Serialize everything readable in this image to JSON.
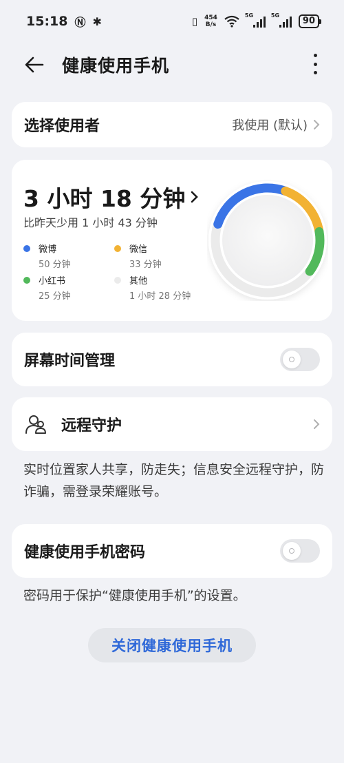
{
  "status_bar": {
    "time": "15:18",
    "net_speed_value": "454",
    "net_speed_unit": "B/s",
    "signal_1_label": "5G",
    "signal_2_label": "5G",
    "battery": "90"
  },
  "header": {
    "title": "健康使用手机"
  },
  "user_select": {
    "label": "选择使用者",
    "value": "我使用 (默认)"
  },
  "usage": {
    "total": "3 小时 18 分钟",
    "compare": "比昨天少用 1 小时 43 分钟",
    "apps": [
      {
        "name": "微博",
        "duration": "50 分钟",
        "color": "#3a74e6"
      },
      {
        "name": "微信",
        "duration": "33 分钟",
        "color": "#f2b233"
      },
      {
        "name": "小红书",
        "duration": "25 分钟",
        "color": "#52b95b"
      },
      {
        "name": "其他",
        "duration": "1 小时 28 分钟",
        "color": "#ebebeb"
      }
    ]
  },
  "chart_data": {
    "type": "pie",
    "categories": [
      "微博",
      "微信",
      "小红书",
      "其他"
    ],
    "values": [
      50,
      33,
      25,
      88
    ],
    "colors": [
      "#3a74e6",
      "#f2b233",
      "#52b95b",
      "#ebebeb"
    ]
  },
  "screen_time": {
    "label": "屏幕时间管理",
    "enabled": false
  },
  "remote": {
    "label": "远程守护",
    "description": "实时位置家人共享，防走失；信息安全远程守护，防诈骗，需登录荣耀账号。"
  },
  "password": {
    "label": "健康使用手机密码",
    "enabled": false,
    "description": "密码用于保护“健康使用手机”的设置。"
  },
  "footer": {
    "close_label": "关闭健康使用手机"
  }
}
